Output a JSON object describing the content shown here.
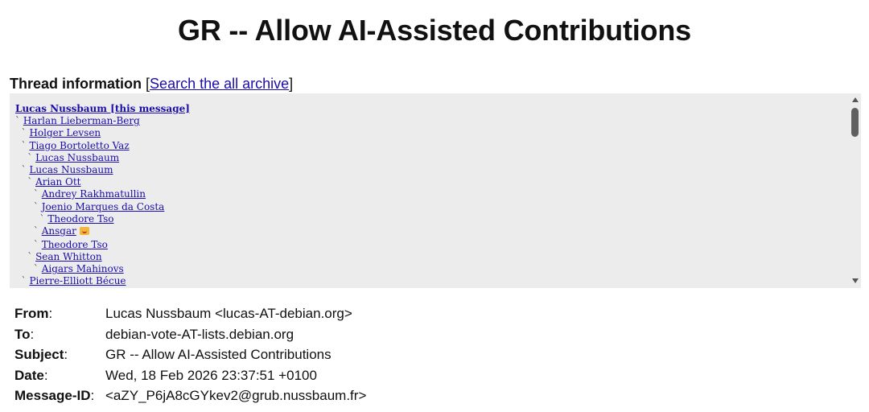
{
  "page": {
    "title": "GR -- Allow AI-Assisted Contributions"
  },
  "thread": {
    "heading": "Thread information",
    "bracket_open": "[",
    "search_link": "Search the all archive",
    "bracket_close": "]",
    "items": [
      {
        "prefix": "",
        "name": "Lucas Nussbaum [this message]",
        "current": true
      },
      {
        "prefix": "` ",
        "name": "Harlan Lieberman-Berg"
      },
      {
        "prefix": "  ` ",
        "name": "Holger Levsen"
      },
      {
        "prefix": "  ` ",
        "name": "Tiago Bortoletto Vaz"
      },
      {
        "prefix": "    ` ",
        "name": "Lucas Nussbaum"
      },
      {
        "prefix": "  ` ",
        "name": "Lucas Nussbaum"
      },
      {
        "prefix": "    ` ",
        "name": "Arian Ott"
      },
      {
        "prefix": "      ` ",
        "name": "Andrey Rakhmatullin"
      },
      {
        "prefix": "      ` ",
        "name": "Joenio Marques da Costa"
      },
      {
        "prefix": "        ` ",
        "name": "Theodore Tso"
      },
      {
        "prefix": "      ` ",
        "name": "Ansgar",
        "emoji": "smiling-cat-emoji"
      },
      {
        "prefix": "      ` ",
        "name": "Theodore Tso"
      },
      {
        "prefix": "    ` ",
        "name": "Sean Whitton"
      },
      {
        "prefix": "      ` ",
        "name": "Aigars Mahinovs"
      },
      {
        "prefix": "  ` ",
        "name": "Pierre-Elliott Bécue"
      }
    ]
  },
  "headers": [
    {
      "key": "From",
      "value": "Lucas Nussbaum <lucas-AT-debian.org>"
    },
    {
      "key": "To",
      "value": "debian-vote-AT-lists.debian.org"
    },
    {
      "key": "Subject",
      "value": "GR -- Allow AI-Assisted Contributions"
    },
    {
      "key": "Date",
      "value": "Wed, 18 Feb 2026 23:37:51 +0100"
    },
    {
      "key": "Message-ID",
      "value": "<aZY_P6jA8cGYkev2@grub.nussbaum.fr>"
    }
  ],
  "header_separator": ":",
  "colors": {
    "link": "#1a0dab",
    "thread_background": "#ececec"
  }
}
